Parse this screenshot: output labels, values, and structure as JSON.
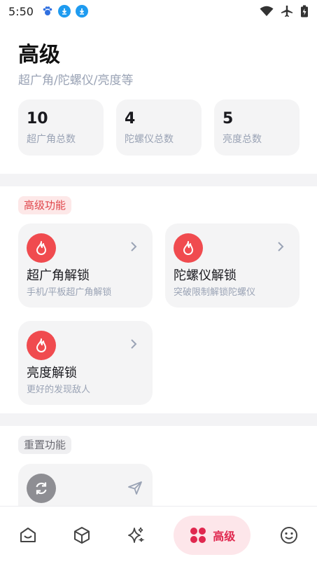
{
  "status_bar": {
    "time": "5:50"
  },
  "header": {
    "title": "高级",
    "subtitle": "超广角/陀螺仪/亮度等"
  },
  "stats": [
    {
      "value": "10",
      "label": "超广角总数"
    },
    {
      "value": "4",
      "label": "陀螺仪总数"
    },
    {
      "value": "5",
      "label": "亮度总数"
    }
  ],
  "sections": {
    "advanced": {
      "label": "高级功能"
    },
    "reset": {
      "label": "重置功能"
    }
  },
  "features": [
    {
      "title": "超广角解锁",
      "desc": "手机/平板超广角解锁"
    },
    {
      "title": "陀螺仪解锁",
      "desc": "突破限制解锁陀螺仪"
    },
    {
      "title": "亮度解锁",
      "desc": "更好的发现敌人"
    }
  ],
  "bottom_nav": {
    "items": [
      "home-icon",
      "cube-icon",
      "sparkles-icon",
      "apps-icon",
      "smile-icon"
    ],
    "active_label": "高级"
  },
  "colors": {
    "accent": "#f04b4f",
    "nav_active": "#e0284f",
    "card_bg": "#f4f4f5",
    "muted_text": "#9aa3b5"
  }
}
